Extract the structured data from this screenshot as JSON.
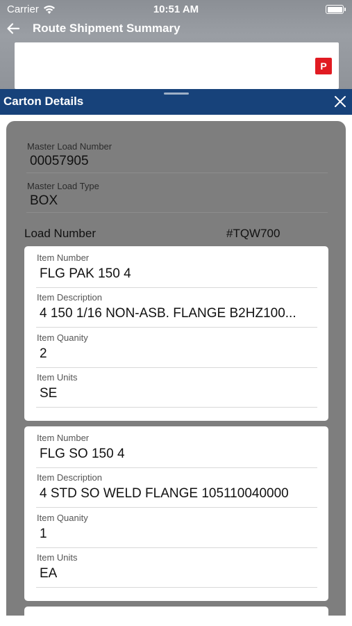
{
  "status_bar": {
    "carrier": "Carrier",
    "time": "10:51 AM"
  },
  "nav": {
    "title": "Route Shipment Summary"
  },
  "summary": {
    "badge": "P"
  },
  "sheet": {
    "title": "Carton Details",
    "master_load_number": {
      "label": "Master Load Number",
      "value": "00057905"
    },
    "master_load_type": {
      "label": "Master Load Type",
      "value": "BOX"
    },
    "load_number": {
      "label": "Load Number",
      "value": "#TQW700"
    },
    "items": [
      {
        "number_label": "Item Number",
        "number": "FLG PAK 150 4",
        "desc_label": "Item Description",
        "desc": "4 150 1/16 NON-ASB. FLANGE B2HZ100...",
        "qty_label": "Item Quanity",
        "qty": "2",
        "units_label": "Item Units",
        "units": "SE"
      },
      {
        "number_label": "Item Number",
        "number": "FLG SO 150 4",
        "desc_label": "Item Description",
        "desc": "4 STD SO WELD FLANGE 105110040000",
        "qty_label": "Item Quanity",
        "qty": "1",
        "units_label": "Item Units",
        "units": "EA"
      }
    ]
  },
  "icons": {
    "back": "arrow-left-icon",
    "close": "close-icon",
    "wifi": "wifi-icon",
    "battery": "battery-icon"
  },
  "colors": {
    "header_blue": "#17427a",
    "badge_red": "#e11b22",
    "panel_gray": "#7e7e7e"
  }
}
